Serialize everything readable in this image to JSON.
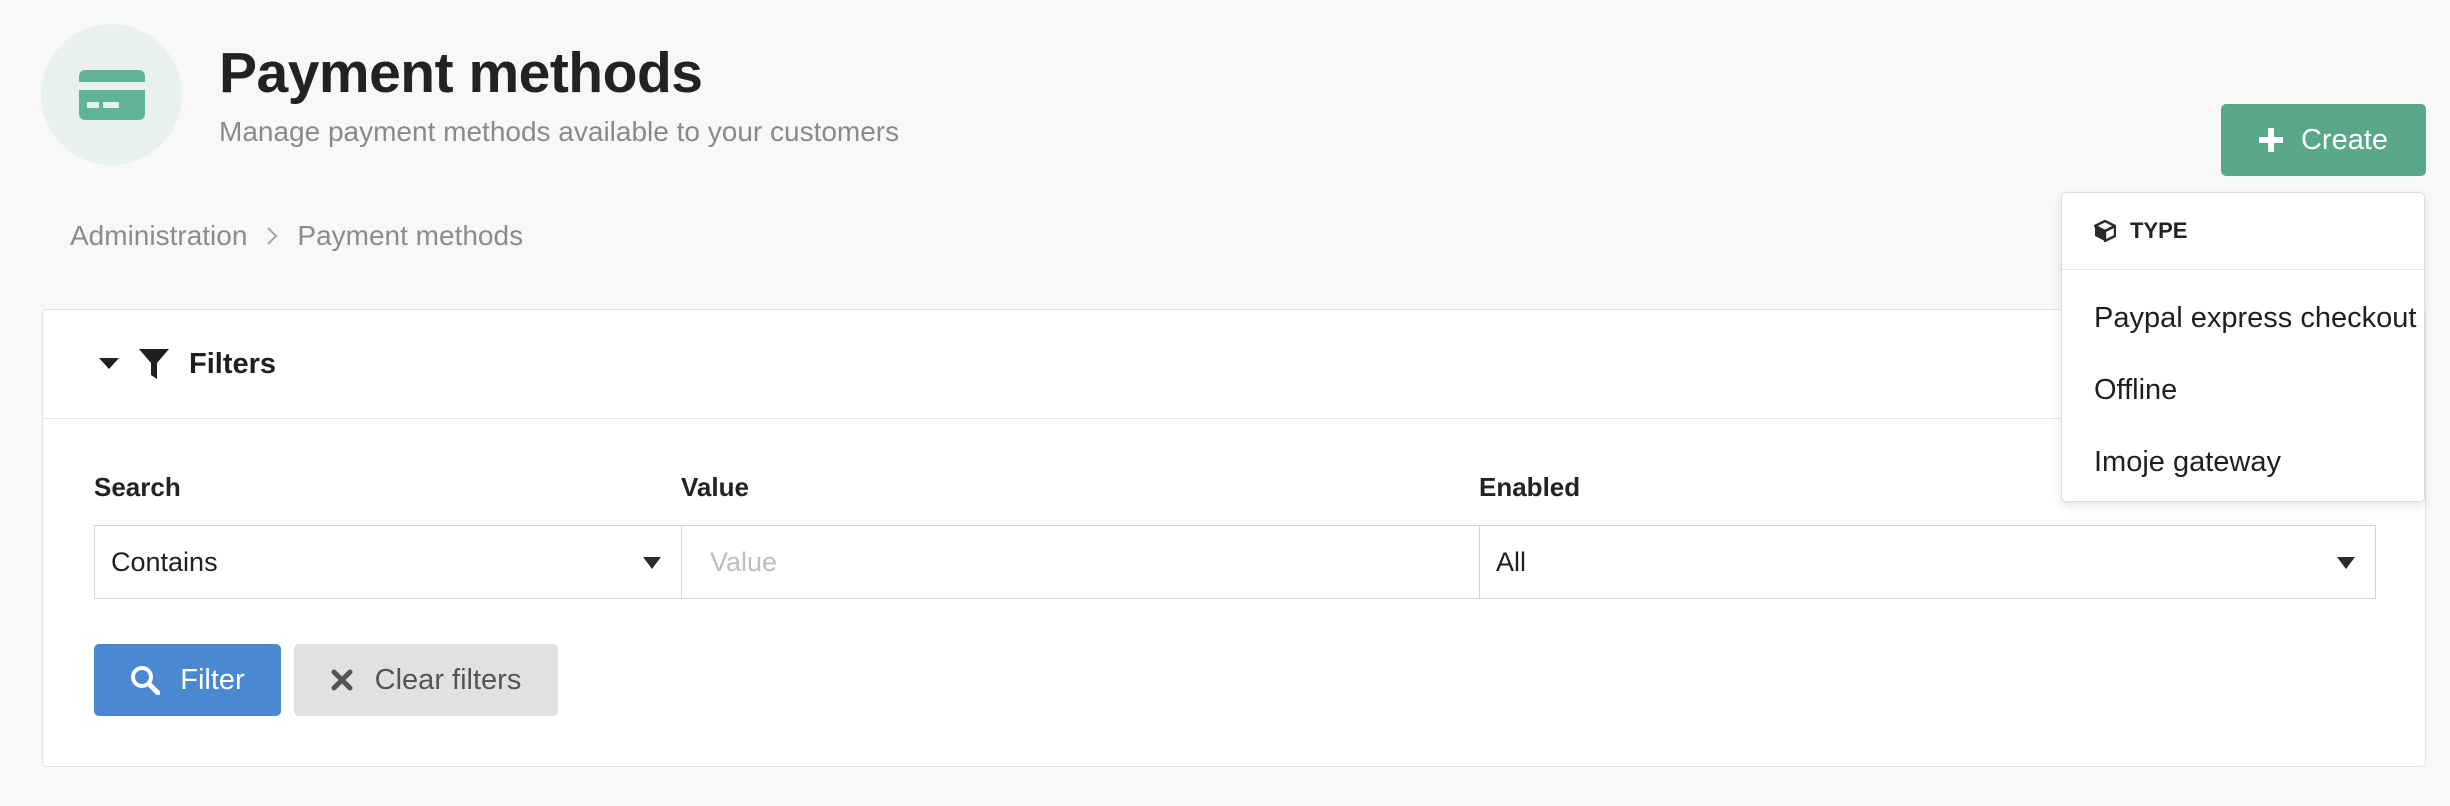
{
  "header": {
    "title": "Payment methods",
    "subtitle": "Manage payment methods available to your customers",
    "icon": "credit-card-icon"
  },
  "actions": {
    "create_label": "Create",
    "create_icon": "plus-icon"
  },
  "breadcrumb": {
    "items": [
      "Administration",
      "Payment methods"
    ],
    "separator_icon": "chevron-right-icon"
  },
  "filters": {
    "title": "Filters",
    "search": {
      "label": "Search",
      "selected": "Contains"
    },
    "value": {
      "label": "Value",
      "placeholder": "Value",
      "current": ""
    },
    "enabled": {
      "label": "Enabled",
      "selected": "All"
    },
    "filter_button": "Filter",
    "clear_button": "Clear filters"
  },
  "create_menu": {
    "header": "TYPE",
    "header_icon": "cube-icon",
    "items": [
      "Paypal express checkout",
      "Offline",
      "Imoje gateway"
    ]
  },
  "colors": {
    "accent_green": "#58a889",
    "primary_blue": "#4a88cf",
    "icon_bg": "#e9f1ee"
  }
}
